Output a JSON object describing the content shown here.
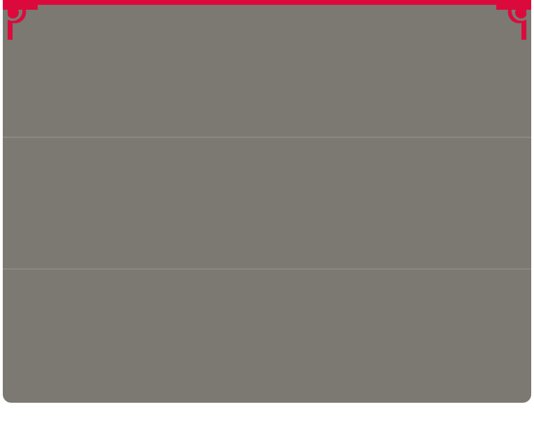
{
  "colors": {
    "panel_background": "#7c7872",
    "accent": "#dc0a3c",
    "divider": "#8e8a84"
  },
  "decorations": {
    "top_left_icon": "corner-ornament-icon",
    "top_right_icon": "corner-ornament-icon"
  },
  "sections": [
    {
      "label": ""
    },
    {
      "label": ""
    },
    {
      "label": ""
    }
  ]
}
